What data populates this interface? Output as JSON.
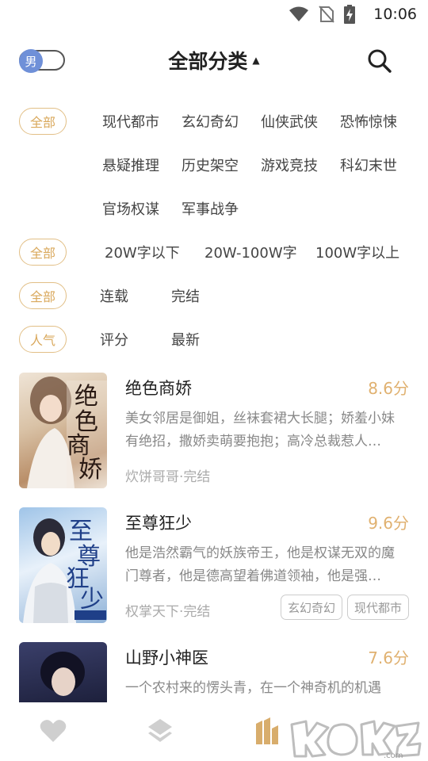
{
  "status_bar": {
    "time": "10:06"
  },
  "header": {
    "gender_label": "男",
    "title": "全部分类",
    "icons": {
      "caret": "caret-up-icon",
      "search": "search-icon"
    }
  },
  "filters": {
    "category": {
      "selected": "全部",
      "options": [
        "现代都市",
        "玄幻奇幻",
        "仙侠武侠",
        "恐怖惊悚",
        "悬疑推理",
        "历史架空",
        "游戏竞技",
        "科幻末世",
        "官场权谋",
        "军事战争"
      ]
    },
    "word_count": {
      "selected": "全部",
      "options": [
        "20W字以下",
        "20W-100W字",
        "100W字以上"
      ]
    },
    "status": {
      "selected": "全部",
      "options": [
        "连载",
        "完结"
      ]
    },
    "sort": {
      "selected": "人气",
      "options": [
        "评分",
        "最新"
      ]
    }
  },
  "books": [
    {
      "title": "绝色商娇",
      "score": "8.6分",
      "desc": "美女邻居是御姐，丝袜套裙大长腿；娇羞小妹有绝招，撒娇卖萌要抱抱；高冷总裁惹人…",
      "meta": "炊饼哥哥·完结",
      "tags": [],
      "cover_title": "绝色商娇"
    },
    {
      "title": "至尊狂少",
      "score": "9.6分",
      "desc": "他是浩然霸气的妖族帝王，他是权谋无双的魔门尊者，他是德高望着佛道领袖，他是强…",
      "meta": "权掌天下·完结",
      "tags": [
        "玄幻奇幻",
        "现代都市"
      ],
      "cover_title": "至尊狂少"
    },
    {
      "title": "山野小神医",
      "score": "7.6分",
      "desc": "一个农村来的愣头青，在一个神奇机的机遇",
      "meta": "",
      "tags": [],
      "cover_title": ""
    }
  ],
  "bottom_nav": {
    "icons": [
      "heart-icon",
      "layers-icon",
      "library-icon"
    ],
    "active_index": 2,
    "watermark": "KOKOZ.com"
  },
  "colors": {
    "accent": "#e0b170",
    "pill_border": "#e2bf86",
    "toggle_knob": "#6f90d8"
  }
}
